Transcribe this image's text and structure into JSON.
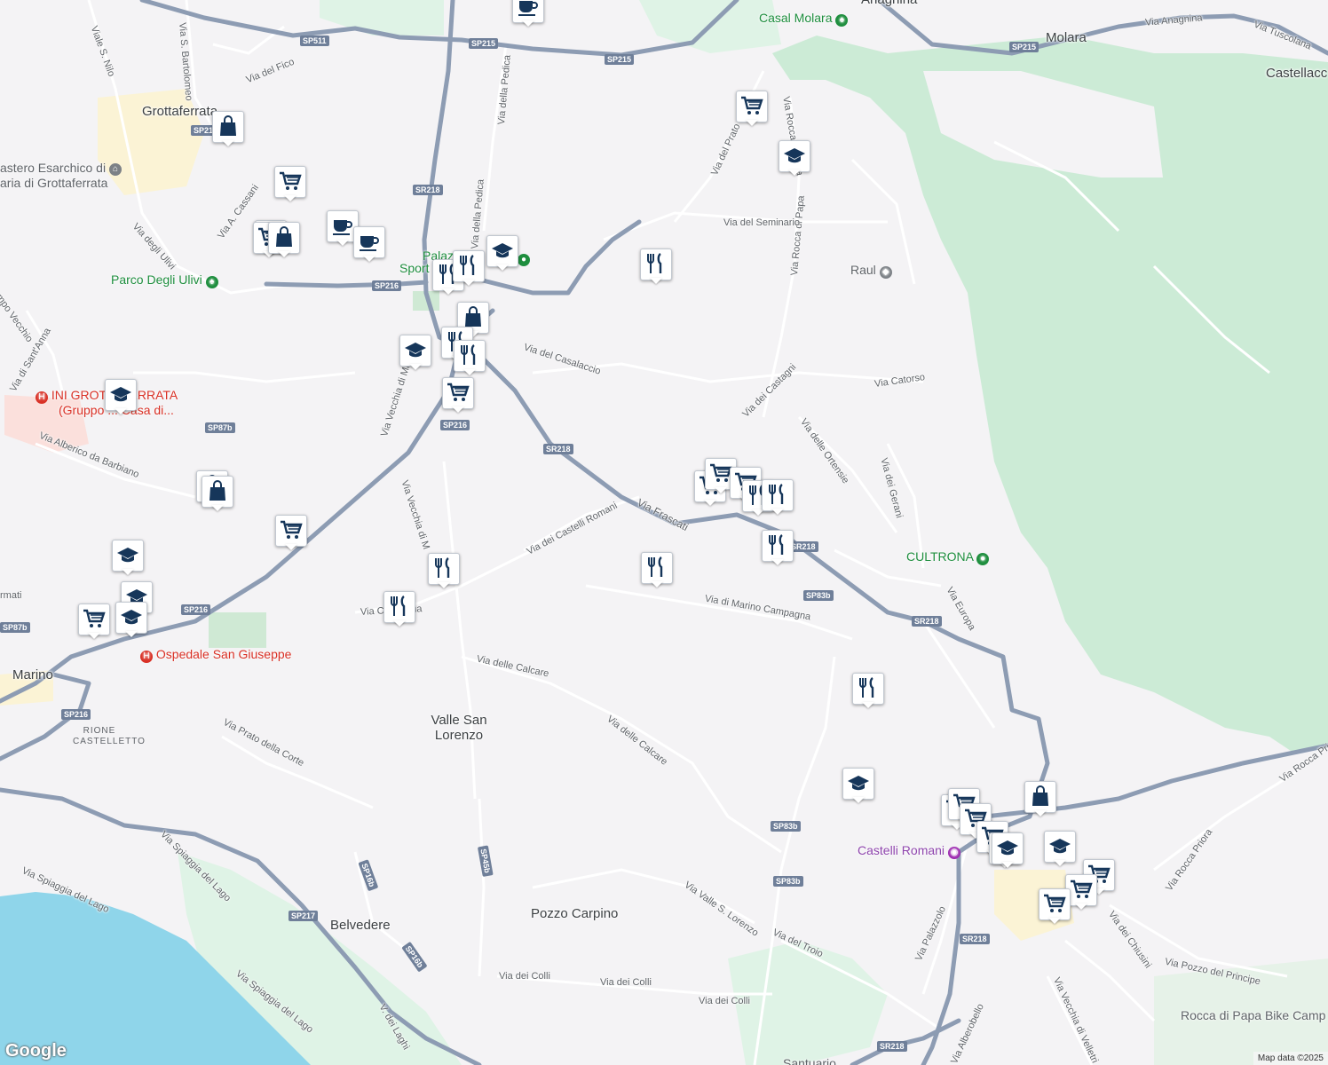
{
  "map": {
    "attribution": "Map data ©2025",
    "logo": "Google",
    "colors": {
      "land": "#f4f3f5",
      "park": "#dff3e6",
      "forest": "#ccebd6",
      "water": "#8fd5ea",
      "road_major": "#8d9cb3",
      "road_minor": "#ffffff",
      "urban": "#fbf3d5",
      "marker_icon": "#16365a"
    }
  },
  "places": {
    "grottaferrata": "Grottaferrata",
    "marino": "Marino",
    "valle_san_lorenzo": "Valle San Lorenzo",
    "pozzo_carpino": "Pozzo Carpino",
    "belvedere": "Belvedere",
    "molara": "Molara",
    "castellaccio": "Castellacc",
    "anagnina": "Anagnina",
    "rione_castelletto": "RIONE CASTELLETTO"
  },
  "pois": {
    "casal_molara": "Casal Molara",
    "parco_ulivi": "Parco Degli Ulivi",
    "palazzo": "Palaz",
    "sport": "Sport",
    "cultrona": "CULTRONA",
    "raul": "Raul",
    "monastero": "astero Esarchico di",
    "monastero2": "aria di Grottaferrata",
    "ini_grottaferrata": "INI GROTTAFERRATA",
    "gruppo": "(Gruppo ... Casa di...",
    "ospedale": "Ospedale San Giuseppe",
    "castelli_romani": "Castelli Romani",
    "rocca_bike": "Rocca di Papa Bike Camp",
    "santuario": "Santuario"
  },
  "streets": {
    "via_anagnina": "Via Anagnina",
    "via_tuscolana": "Via Tuscolana",
    "viale_s_nilo": "Viale S. Nilo",
    "via_s_bartolomeo": "Via S. Bartolomeo",
    "via_del_fico": "Via del Fico",
    "via_della_pedica": "Via della Pedica",
    "via_della_pedica2": "Via della Pedica",
    "via_del_prato": "Via del Prato",
    "via_rocca_di_papa": "Via Rocca di Papa",
    "via_rocca_di_papa2": "Via Rocca di Papa",
    "via_del_seminario": "Via del Seminario",
    "via_degli_ulivi": "Via degli Ulivi",
    "via_a_cassani": "Via A. Cassani",
    "via_campo_vecchio": "mpo Vecchio",
    "via_di_santanna": "Via di Sant'Anna",
    "via_del_casalaccio": "Via del Casalaccio",
    "via_dei_castagni": "Via dei Castagni",
    "via_catorso": "Via Catorso",
    "via_delle_ortensie": "Via delle Ortensie",
    "via_dei_gerani": "Via dei Gerani",
    "via_vecchia_di_marino": "Via Vecchia di Ma",
    "via_vecchia_di_marino2": "Via Vecchia di M",
    "via_alberico": "Via Alberico da Barbiano",
    "via_frascati": "Via Frascati",
    "via_dei_castelli_romani": "Via dei Castelli Romani",
    "via_di_marino_campagna": "Via di Marino Campagna",
    "via_acqua": "Via C... Acqua",
    "via_europa": "Via Europa",
    "via_delle_calcare": "Via delle Calcare",
    "via_delle_calcare2": "Via delle Calcare",
    "via_prato_della_corte": "Via Prato della Corte",
    "via_spiaggia_del_lago": "Via Spiaggia del Lago",
    "via_spiaggia_del_lago2": "Via Spiaggia del Lago",
    "via_spiaggia_del_lago3": "Via Spiaggia del Lago",
    "via_valle_s_lorenzo": "Via Valle S. Lorenzo",
    "via_del_troio": "Via del Troio",
    "via_dei_colli1": "Via dei Colli",
    "via_dei_colli2": "Via dei Colli",
    "via_dei_colli3": "Via dei Colli",
    "via_dei_laghi": "V. dei Laghi",
    "via_palazzolo": "Via Palazzolo",
    "via_aberobello": "Via Alberobello",
    "via_vecchia_di_velletri": "Via Vecchia di Velletri",
    "via_dei_chiusini": "Via dei Chiusini",
    "via_pozzo_del_principe": "Via Pozzo del Principe",
    "via_rocca_priora": "Via Rocca Priora",
    "via_rocca_priora2": "Via Rocca Priora",
    "via_ermati": "rmati",
    "via_di_s": "Via d... S..."
  },
  "shields": {
    "sp511": "SP511",
    "sp215a": "SP215",
    "sp215b": "SP215",
    "sp215c": "SP215",
    "sp21": "SP21",
    "sr218a": "SR218",
    "sp216a": "SP216",
    "sp216b": "SP216",
    "sp216c": "SP216",
    "sp216d": "SP216",
    "sp87b": "SP87b",
    "sp87b2": "SP87b",
    "sr218b": "SR218",
    "sr218c": "SR218",
    "sr218d": "SR218",
    "sr218e": "SR218",
    "sr218f": "SR218",
    "sp83b1": "SP83b",
    "sp83b2": "SP83b",
    "sp83b3": "SP83b",
    "sp217": "SP217",
    "sp16b1": "SP16b",
    "sp16b2": "SP16b",
    "sp45b": "SP45b"
  },
  "markers": [
    {
      "type": "cafe"
    },
    {
      "type": "grocery"
    },
    {
      "type": "school"
    },
    {
      "type": "shopping"
    },
    {
      "type": "grocery"
    },
    {
      "type": "grocery"
    },
    {
      "type": "cafe"
    },
    {
      "type": "cafe"
    },
    {
      "type": "grocery"
    },
    {
      "type": "shopping"
    },
    {
      "type": "restaurant"
    },
    {
      "type": "restaurant"
    },
    {
      "type": "school"
    },
    {
      "type": "restaurant"
    },
    {
      "type": "shopping"
    },
    {
      "type": "restaurant"
    },
    {
      "type": "school"
    },
    {
      "type": "restaurant"
    },
    {
      "type": "grocery"
    },
    {
      "type": "school"
    },
    {
      "type": "shopping"
    },
    {
      "type": "shopping"
    },
    {
      "type": "school"
    },
    {
      "type": "school"
    },
    {
      "type": "school"
    },
    {
      "type": "grocery"
    },
    {
      "type": "restaurant"
    },
    {
      "type": "restaurant"
    },
    {
      "type": "restaurant"
    },
    {
      "type": "grocery"
    },
    {
      "type": "grocery"
    },
    {
      "type": "grocery"
    },
    {
      "type": "restaurant"
    },
    {
      "type": "restaurant"
    },
    {
      "type": "restaurant"
    },
    {
      "type": "grocery"
    },
    {
      "type": "restaurant"
    },
    {
      "type": "school"
    },
    {
      "type": "school"
    },
    {
      "type": "grocery"
    },
    {
      "type": "grocery"
    },
    {
      "type": "grocery"
    },
    {
      "type": "grocery"
    },
    {
      "type": "grocery"
    },
    {
      "type": "shopping"
    },
    {
      "type": "school"
    },
    {
      "type": "grocery"
    },
    {
      "type": "grocery"
    },
    {
      "type": "grocery"
    }
  ]
}
